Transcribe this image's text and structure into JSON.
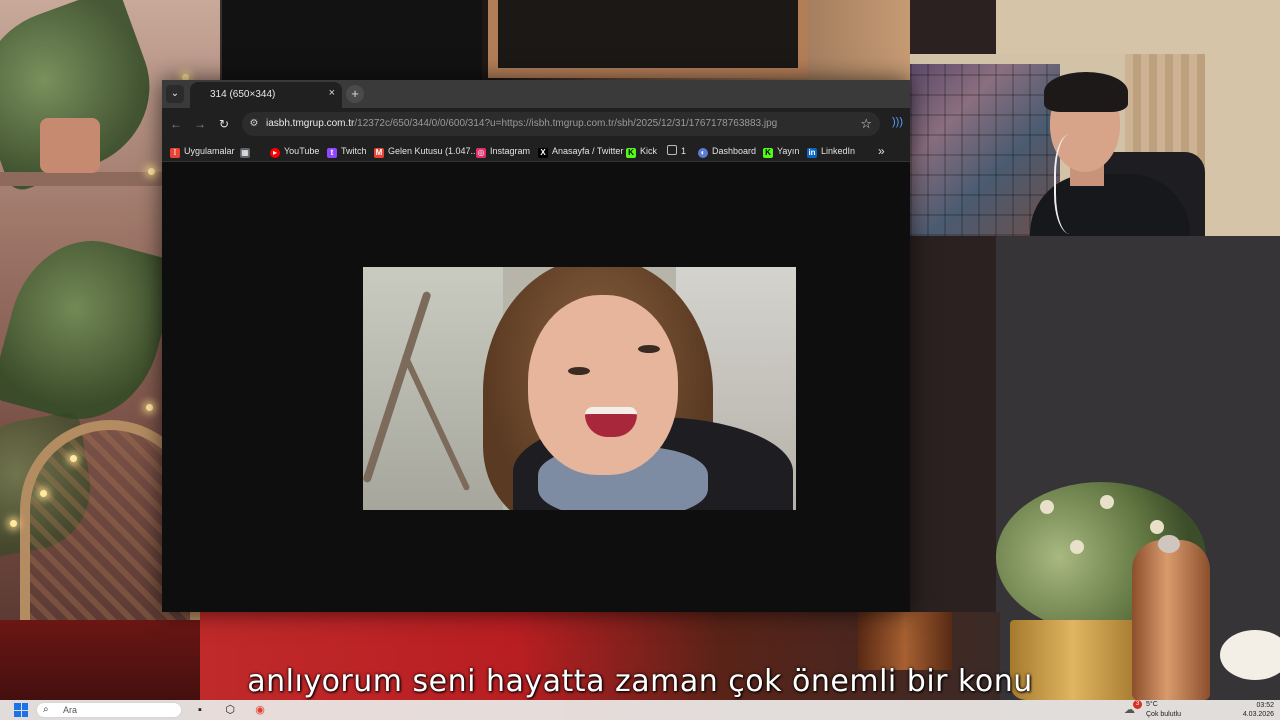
{
  "browser": {
    "tab_search_icon": "chevron-down-icon",
    "tab": {
      "title": "314 (650×344)",
      "close_glyph": "×"
    },
    "new_tab_glyph": "+",
    "nav": {
      "back": "←",
      "forward": "→",
      "reload": "↻"
    },
    "omnibox": {
      "host": "iasbh.tmgrup.com.tr",
      "path": "/12372c/650/344/0/0/600/314?u=https://isbh.tmgrup.com.tr/sbh/2025/12/31/1767178763883.jpg",
      "site_info_icon": "tune-icon",
      "star_glyph": "☆"
    },
    "extension_icon": "audio-icon",
    "bookmarks": [
      {
        "label": "Uygulamalar",
        "icon": "apps-grid-icon",
        "color": "#ea4335"
      },
      {
        "label": "",
        "icon": "grid-icon",
        "color": "#9aa0a6"
      },
      {
        "label": "YouTube",
        "icon": "youtube-icon",
        "color": "#ff0000"
      },
      {
        "label": "Twitch",
        "icon": "twitch-icon",
        "color": "#9146ff"
      },
      {
        "label": "Gelen Kutusu (1.047...",
        "icon": "gmail-icon",
        "color": "#ea4335"
      },
      {
        "label": "Instagram",
        "icon": "instagram-icon",
        "color": "#e1306c"
      },
      {
        "label": "Anasayfa / Twitter",
        "icon": "x-icon",
        "color": "#000000"
      },
      {
        "label": "Kick",
        "icon": "kick-icon",
        "color": "#53fc18"
      },
      {
        "label": "1",
        "icon": "folder-icon",
        "color": "#9aa0a6"
      },
      {
        "label": "Dashboard",
        "icon": "dashboard-icon",
        "color": "#5b7bd5"
      },
      {
        "label": "Yayın",
        "icon": "kick-icon",
        "color": "#53fc18"
      },
      {
        "label": "LinkedIn",
        "icon": "linkedin-icon",
        "color": "#0a66c2"
      }
    ],
    "bookmarks_overflow_glyph": "»"
  },
  "subtitle": "anlıyorum seni hayatta zaman çok önemli bir konu",
  "taskbar": {
    "search_placeholder": "Ara",
    "weather": {
      "badge": "3",
      "temp": "5°C",
      "desc": "Çok bulutlu"
    },
    "clock": {
      "time": "03:52",
      "date": "4.03.2026"
    }
  }
}
